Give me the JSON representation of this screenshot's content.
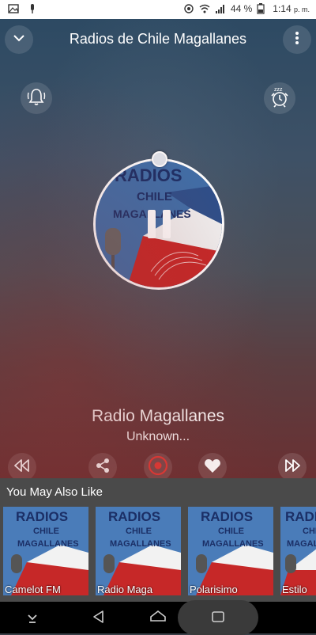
{
  "status_bar": {
    "battery": "44 %",
    "time": "1:14",
    "ampm": "p. m."
  },
  "header": {
    "title": "Radios de Chile Magallanes"
  },
  "cover": {
    "line1": "RADIOS",
    "line2": "CHILE",
    "line3": "MAGALLANES"
  },
  "now_playing": {
    "station": "Radio Magallanes",
    "subtitle": "Unknown...",
    "progress": 0
  },
  "recommendations": {
    "title": "You May Also Like",
    "items": [
      {
        "label": "Camelot FM",
        "art_line1": "RADIOS",
        "art_line2": "CHILE",
        "art_line3": "MAGALLANES"
      },
      {
        "label": "Radio Maga",
        "art_line1": "RADIOS",
        "art_line2": "CHILE",
        "art_line3": "MAGALLANES"
      },
      {
        "label": "Polarisimo",
        "art_line1": "RADIOS",
        "art_line2": "CHILE",
        "art_line3": "MAGALLANES"
      },
      {
        "label": "Estilo",
        "art_line1": "RADIOS",
        "art_line2": "CHILE",
        "art_line3": "MAGALLANES"
      }
    ]
  },
  "colors": {
    "accent": "#e53935",
    "status_bar_bg": "#ffffff",
    "section_bg": "#4a4a4a",
    "nav_bg": "#000000"
  }
}
